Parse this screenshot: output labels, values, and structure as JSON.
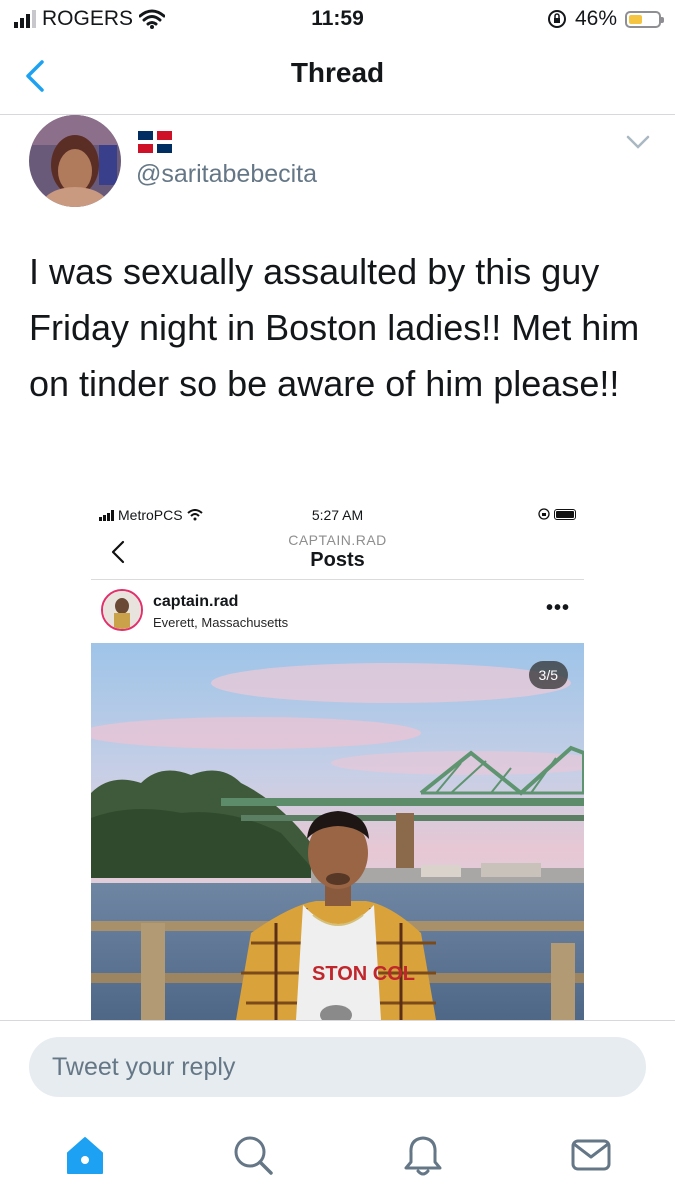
{
  "status_bar": {
    "carrier": "ROGERS",
    "time": "11:59",
    "battery": "46%",
    "battery_level": 0.46
  },
  "nav": {
    "title": "Thread"
  },
  "tweet": {
    "handle": "@saritabebecita",
    "text": "I was sexually assaulted by this guy Friday night in Boston ladies!! Met him on tinder so be aware of him please!!"
  },
  "embed": {
    "status_bar": {
      "carrier": "MetroPCS",
      "time": "5:27 AM"
    },
    "nav": {
      "subtitle": "CAPTAIN.RAD",
      "title": "Posts"
    },
    "post": {
      "username": "captain.rad",
      "location": "Everett, Massachusetts",
      "more": "•••",
      "counter": "3/5",
      "shirt_text": "STON COL"
    }
  },
  "reply": {
    "placeholder": "Tweet your reply"
  },
  "tabs": [
    {
      "icon": "home-icon"
    },
    {
      "icon": "search-icon"
    },
    {
      "icon": "notifications-icon"
    },
    {
      "icon": "messages-icon"
    }
  ],
  "colors": {
    "accent": "#1da1f2",
    "secondary_text": "#657786",
    "reply_bg": "#e6ecf0",
    "battery_fill": "#f5c542"
  }
}
